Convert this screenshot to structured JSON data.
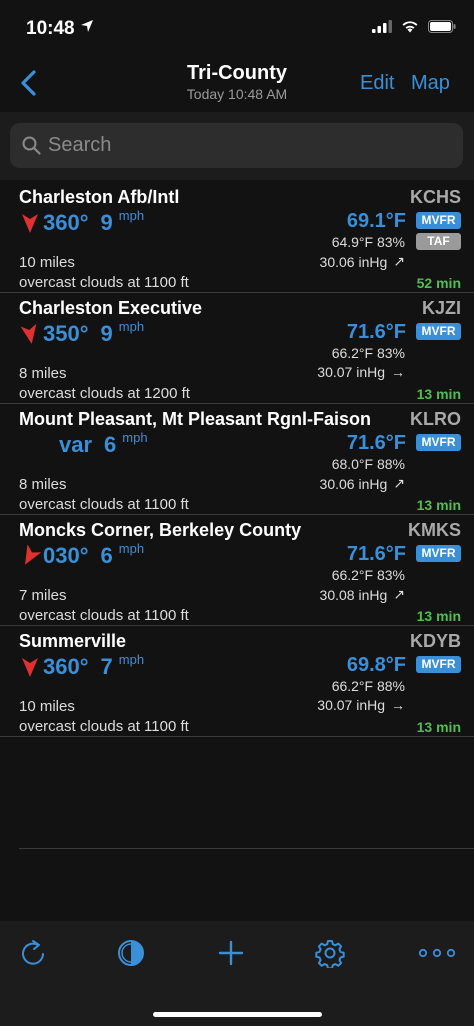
{
  "status_bar": {
    "time": "10:48"
  },
  "nav": {
    "title": "Tri-County",
    "subtitle": "Today 10:48 AM",
    "edit_label": "Edit",
    "map_label": "Map"
  },
  "search": {
    "placeholder": "Search"
  },
  "colors": {
    "accent": "#3a8fd9",
    "arrow": "#e03030",
    "age": "#4fbf4f",
    "badge_mvfr": "#3a8fd9",
    "badge_taf": "#9a9a9a"
  },
  "stations": [
    {
      "name": "Charleston Afb/Intl",
      "ident": "KCHS",
      "wind_dir": "360°",
      "wind_speed": "9",
      "wind_unit": "mph",
      "wind_arrow": true,
      "temp": "69.1°F",
      "category": "MVFR",
      "taf": "TAF",
      "dew_humidity": "64.9°F 83%",
      "pressure": "30.06 inHg",
      "pressure_trend": "↗",
      "visibility": "10 miles",
      "weather": "overcast clouds at 1100 ft",
      "age": "52 min"
    },
    {
      "name": "Charleston Executive",
      "ident": "KJZI",
      "wind_dir": "350°",
      "wind_speed": "9",
      "wind_unit": "mph",
      "wind_arrow": true,
      "temp": "71.6°F",
      "category": "MVFR",
      "dew_humidity": "66.2°F 83%",
      "pressure": "30.07 inHg",
      "pressure_trend": "→",
      "visibility": "8 miles",
      "weather": "overcast clouds at 1200 ft",
      "age": "13 min"
    },
    {
      "name": "Mount Pleasant, Mt Pleasant Rgnl-Faison",
      "ident": "KLRO",
      "wind_dir": "var",
      "wind_speed": "6",
      "wind_unit": "mph",
      "wind_arrow": false,
      "temp": "71.6°F",
      "category": "MVFR",
      "dew_humidity": "68.0°F 88%",
      "pressure": "30.06 inHg",
      "pressure_trend": "↗",
      "visibility": "8 miles",
      "weather": "overcast clouds at 1100 ft",
      "age": "13 min"
    },
    {
      "name": "Moncks Corner, Berkeley County",
      "ident": "KMKS",
      "wind_dir": "030°",
      "wind_speed": "6",
      "wind_unit": "mph",
      "wind_arrow": true,
      "temp": "71.6°F",
      "category": "MVFR",
      "dew_humidity": "66.2°F 83%",
      "pressure": "30.08 inHg",
      "pressure_trend": "↗",
      "visibility": "7 miles",
      "weather": "overcast clouds at 1100 ft",
      "age": "13 min"
    },
    {
      "name": "Summerville",
      "ident": "KDYB",
      "wind_dir": "360°",
      "wind_speed": "7",
      "wind_unit": "mph",
      "wind_arrow": true,
      "temp": "69.8°F",
      "category": "MVFR",
      "dew_humidity": "66.2°F 88%",
      "pressure": "30.07 inHg",
      "pressure_trend": "→",
      "visibility": "10 miles",
      "weather": "overcast clouds at 1100 ft",
      "age": "13 min"
    }
  ],
  "toolbar": {
    "items": [
      "refresh-icon",
      "contrast-icon",
      "add-icon",
      "gear-icon",
      "more-icon"
    ]
  }
}
